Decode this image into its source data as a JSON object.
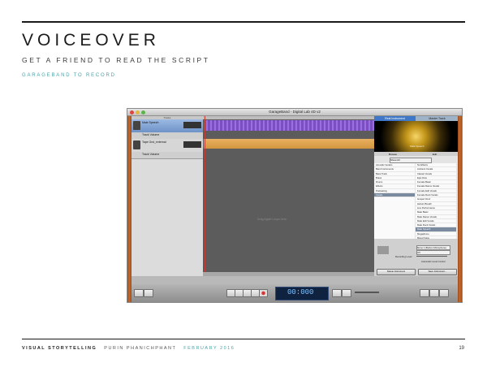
{
  "header": {
    "title": "VOICEOVER",
    "subtitle": "GET A FRIEND TO READ THE SCRIPT",
    "note": "GARAGEBAND TO RECORD"
  },
  "screenshot": {
    "window_title": "GarageBand - Digital Lab 4D v2",
    "tracks_header": "Tracks",
    "tracks": [
      {
        "name": "Male Speech"
      },
      {
        "name": "Track Volume"
      },
      {
        "name": "Tape Gnd_external"
      },
      {
        "name": "Track Volume"
      },
      {
        "name": "Track Volume"
      }
    ],
    "empty_area_text": "Drag Apple Loops here.",
    "panel_tabs": [
      "Real Instrument",
      "Master Track"
    ],
    "stage_caption": "Male Speech",
    "sub_tabs": [
      "Browse",
      "Edit"
    ],
    "show_filter": "Show All",
    "left_list": [
      "Acoustic Guitars",
      "Band Instruments",
      "Bass Track",
      "Brass",
      "Drums",
      "Effects",
      "Podcasting",
      "Vocals"
    ],
    "right_list": [
      "No Effects",
      "Ambient Vocals",
      "Classic Vocals",
      "Epic Diva",
      "Female Basic",
      "Female Dance Vocals",
      "Female Edit Vocals",
      "Female Rock Vocals",
      "Gospel Choir",
      "Helium Breath",
      "Live Performance",
      "Male Basic",
      "Male Dance Vocals",
      "Male Edit Vocals",
      "Male Rock Vocals",
      "Male Speech",
      "Megaphone",
      "Mixed Voice",
      "Pop Vocals"
    ],
    "settings": {
      "input_source": "Mono 1 (Built-in Microphone)",
      "monitor": "Off",
      "recording_level": "Recording Level:",
      "auto_level": "Automatic Level Control"
    },
    "buttons": [
      "Delete Instrument",
      "Save Instrument..."
    ],
    "lcd_time": "00:000"
  },
  "footer": {
    "series": "VISUAL STORYTELLING",
    "author": "PURIN PHANICHPHANT",
    "date": "FEBRUARY 2016",
    "page": "19"
  }
}
